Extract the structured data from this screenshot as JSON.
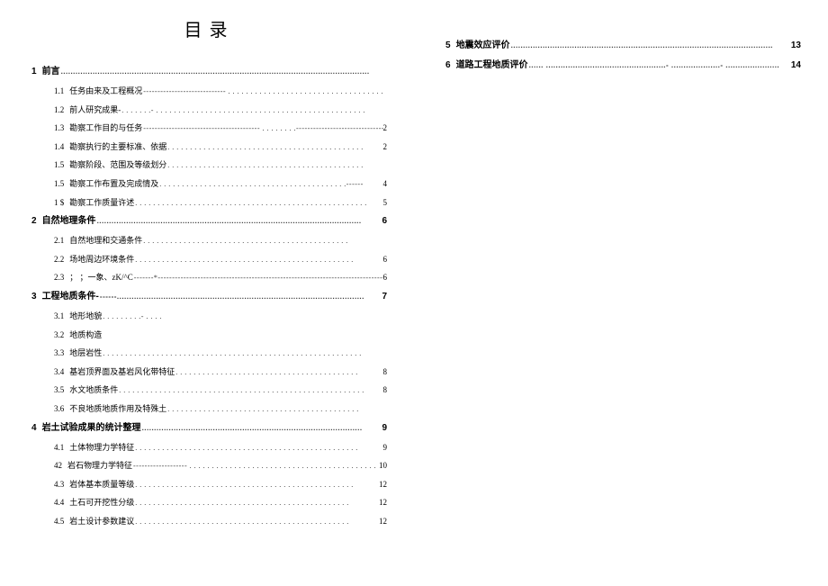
{
  "title": "目录",
  "left": {
    "sections": [
      {
        "num": "1",
        "title": "前言",
        "page": "",
        "leader": "..............................................................................................................................",
        "items": [
          {
            "num": "1.1",
            "title": "任务由来及工程概况",
            "leader": "----------------------------- . . . . . . . . . . . . . . . . . . . . . . . . . . . . . . . . . . .",
            "page": ""
          },
          {
            "num": "1.2",
            "title": "前人研究成果-",
            "leader": ". . . . . . .- . . . . . . . . . . . . . . . . . . . . . . . . . . . . . . . . . . . . . . . . . . . . . . .",
            "page": ""
          },
          {
            "num": "1.3",
            "title": "勘察工作目的与任务",
            "leader": "----------------------------------------- . . . . . . . .-------------------------------------------",
            "page": "2"
          },
          {
            "num": "1.4",
            "title": "勘察执行的主要标准、依据",
            "leader": ". . . . . . . . . . . . . . . . . . . . . . . . . . . . . . . . . . . . . . . . . . . .",
            "page": "2"
          },
          {
            "num": "1.5",
            "title": "勘察阶段、范围及等级划分",
            "leader": ". . . . . . . . . . . . . . . . . . . . . . . . . . . . . . . . . . . . . . . . . . . .",
            "page": ""
          },
          {
            "num": "1.5",
            "title": "勘察工作布置及完成情及",
            "leader": ". . . . . . . . . . . . . . . . . . . . . . . . . . . . . . . . . . . . . . . . . .------",
            "page": "4"
          },
          {
            "num": "1 $",
            "title": "勘察工作质量许述",
            "leader": ". . . . . . . . . . . . . . . . . . . . . . . . . . . . . . . . . . . . . . . . . . . . . . . . . . . .",
            "page": "5"
          }
        ]
      },
      {
        "num": "2",
        "title": "自然地理条件",
        "page": "6",
        "leader": "............................................................................................................",
        "items": [
          {
            "num": "2.1",
            "title": "自然地理和交通条件",
            "leader": ". . . . . . . . . . . . . . . . . . . . . . . . . . . . . . . . . . . . . . . . . . . . . .",
            "page": ""
          },
          {
            "num": "2.2",
            "title": "场地周边环境条件",
            "leader": ". . . . . . . . . . . . . . . . . . . . . . . . . . . . . . . . . . . . . . . . . . . . . . . . .",
            "page": "6"
          },
          {
            "num": "2.3",
            "title": "； ；一象、zK/^C",
            "leader": "-------*-----------------------------------------------------------------------------------------",
            "page": "6"
          }
        ]
      },
      {
        "num": "3",
        "title": "工程地质条件-",
        "page": "7",
        "leader": "------.....................................................................................................",
        "items": [
          {
            "num": "3.1",
            "title": "地形地貌",
            "leader": ". . . . . . . . .- . . . .",
            "page": ""
          },
          {
            "num": "3.2",
            "title": "地质构造",
            "leader": "",
            "page": ""
          },
          {
            "num": "3.3",
            "title": "地层岩性",
            "leader": ". . . . . . . . . . . . . . . . . . . . . . . . . . . . . . . . . . . . . . . . . . . . . . . . . . . . . . . . . .",
            "page": ""
          },
          {
            "num": "3.4",
            "title": "基岩顶界面及基岩风化带特征",
            "leader": ". . . . . . . . . . . . . . . . . . . . . . . . . . . . . . . . . . . . . . . . .",
            "page": "8"
          },
          {
            "num": "3.5",
            "title": "水文地质条件",
            "leader": ". . . . . . . . . . . . . . . . . . . . . . . . . . . . . . . . . . . . . . . . . . . . . . . . . . . . . . .",
            "page": "8"
          },
          {
            "num": "3.6",
            "title": "不良地质地质作用及特殊土",
            "leader": ". . . . . . . . . . . . . . . . . . . . . . . . . . . . . . . . . . . . . . . . . . .",
            "page": ""
          }
        ]
      },
      {
        "num": "4",
        "title": "岩土试验成果的统计整理",
        "page": "9",
        "leader": "..........................................................................................",
        "items": [
          {
            "num": "4.1",
            "title": "土体物理力学特征",
            "leader": ". . . . . . . . . . . . . . . . . . . . . . . . . . . . . . . . . . . . . . . . . . . . . . . . . .",
            "page": "9"
          },
          {
            "num": "42",
            "title": "岩石物理力学特征",
            "leader": "------------------- . . . . . . . . . . . . . . . . . . . . . . . . . . . . . . . . . . . . . . . . . . .",
            "page": "10"
          },
          {
            "num": "4.3",
            "title": "岩体基本质量等级",
            "leader": ". . . . . . . . . . . . . . . . . . . . . . . . . . . . . . . . . . . . . . . . . . . . . . . . .",
            "page": "12"
          },
          {
            "num": "4.4",
            "title": "土石可开挖性分级",
            "leader": ". . . . . . . . . . . . . . . . . . . . . . . . . . . . . . . . . . . . . . . . . . . . . . . .",
            "page": "12"
          },
          {
            "num": "4.5",
            "title": "岩土设计参数建议",
            "leader": ". . . . . . . . . . . . . . . . . . . . . . . . . . . . . . . . . . . . . . . . . . . . . . . .",
            "page": "12"
          }
        ]
      }
    ]
  },
  "right": {
    "sections": [
      {
        "num": "5",
        "title": "地震效应评价",
        "leader": "...........................................................................................................",
        "page": "13"
      },
      {
        "num": "6",
        "title": "道路工程地质评价",
        "leader": "......  .................................................- ....................-  ......................",
        "page": "14"
      }
    ]
  }
}
